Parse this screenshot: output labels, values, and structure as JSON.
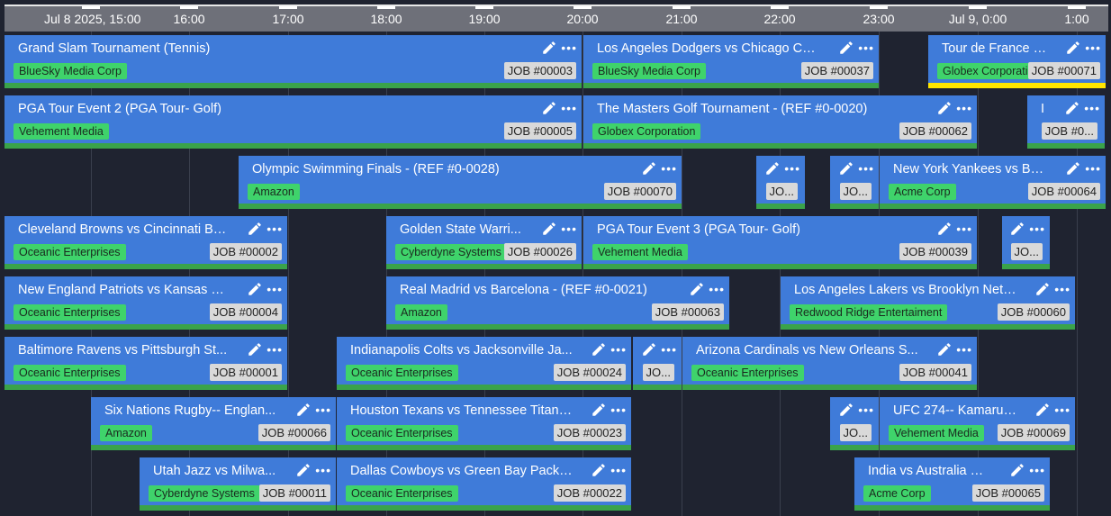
{
  "axis": {
    "ticks": [
      {
        "label": "Jul 8 2025, 15:00",
        "bold": false
      },
      {
        "label": "16:00"
      },
      {
        "label": "17:00"
      },
      {
        "label": "18:00"
      },
      {
        "label": "19:00"
      },
      {
        "label": "20:00"
      },
      {
        "label": "21:00"
      },
      {
        "label": "22:00"
      },
      {
        "label": "23:00"
      },
      {
        "label": "Jul 9, 0:00"
      },
      {
        "label": "1:00"
      }
    ]
  },
  "colors": {
    "card": "#3f7bd9",
    "tag": "#3fd36b",
    "bar": "#3aa34a",
    "selected_bar": "#ffe600",
    "background": "#1f2330"
  },
  "items": [
    {
      "title": "Grand Slam Tournament (Tennis)",
      "tag": "BlueSky Media Corp",
      "job": "JOB #00003"
    },
    {
      "title": "Los Angeles Dodgers vs Chicago Cu...",
      "tag": "BlueSky Media Corp",
      "job": "JOB #00037"
    },
    {
      "title": "Tour de France S...",
      "tag": "Globex Corporation",
      "job": "JOB #00071",
      "selected": true
    },
    {
      "title": "PGA Tour Event 2 (PGA Tour- Golf)",
      "tag": "Vehement Media",
      "job": "JOB #00005"
    },
    {
      "title": "The Masters Golf Tournament - (REF #0-0020)",
      "tag": "Globex Corporation",
      "job": "JOB #00062"
    },
    {
      "title": "I",
      "tag": "",
      "job": "JOB #0..."
    },
    {
      "title": "Olympic Swimming Finals - (REF #0-0028)",
      "tag": "Amazon",
      "job": "JOB #00070"
    },
    {
      "title": "",
      "tag": "",
      "job": "JO..."
    },
    {
      "title": "",
      "tag": "",
      "job": "JO..."
    },
    {
      "title": "New York Yankees vs Bos...",
      "tag": "Acme Corp",
      "job": "JOB #00064"
    },
    {
      "title": "Cleveland Browns vs Cincinnati Be...",
      "tag": "Oceanic Enterprises",
      "job": "JOB #00002"
    },
    {
      "title": "Golden State Warri...",
      "tag": "Cyberdyne Systems",
      "job": "JOB #00026"
    },
    {
      "title": "PGA Tour Event 3 (PGA Tour- Golf)",
      "tag": "Vehement Media",
      "job": "JOB #00039"
    },
    {
      "title": "",
      "tag": "",
      "job": "JO..."
    },
    {
      "title": "New England Patriots vs Kansas Ci...",
      "tag": "Oceanic Enterprises",
      "job": "JOB #00004"
    },
    {
      "title": "Real Madrid vs Barcelona - (REF #0-0021)",
      "tag": "Amazon",
      "job": "JOB #00063"
    },
    {
      "title": "Los Angeles Lakers vs Brooklyn Nets...",
      "tag": "Redwood Ridge Entertaiment",
      "job": "JOB #00060"
    },
    {
      "title": "Baltimore Ravens vs Pittsburgh St...",
      "tag": "Oceanic Enterprises",
      "job": "JOB #00001"
    },
    {
      "title": "Indianapolis Colts vs Jacksonville Ja...",
      "tag": "Oceanic Enterprises",
      "job": "JOB #00024"
    },
    {
      "title": "",
      "tag": "",
      "job": "JO..."
    },
    {
      "title": "Arizona Cardinals vs New Orleans S...",
      "tag": "Oceanic Enterprises",
      "job": "JOB #00041"
    },
    {
      "title": "Six Nations Rugby-- Englan...",
      "tag": "Amazon",
      "job": "JOB #00066"
    },
    {
      "title": "Houston Texans vs Tennessee Titans...",
      "tag": "Oceanic Enterprises",
      "job": "JOB #00023"
    },
    {
      "title": "",
      "tag": "",
      "job": "JO..."
    },
    {
      "title": "UFC 274-- Kamaru ...",
      "tag": "Vehement Media",
      "job": "JOB #00069"
    },
    {
      "title": "Utah Jazz vs Milwa...",
      "tag": "Cyberdyne Systems",
      "job": "JOB #00011"
    },
    {
      "title": "Dallas Cowboys vs Green Bay Packer...",
      "tag": "Oceanic Enterprises",
      "job": "JOB #00022"
    },
    {
      "title": "India vs Australia Cr...",
      "tag": "Acme Corp",
      "job": "JOB #00065"
    }
  ]
}
